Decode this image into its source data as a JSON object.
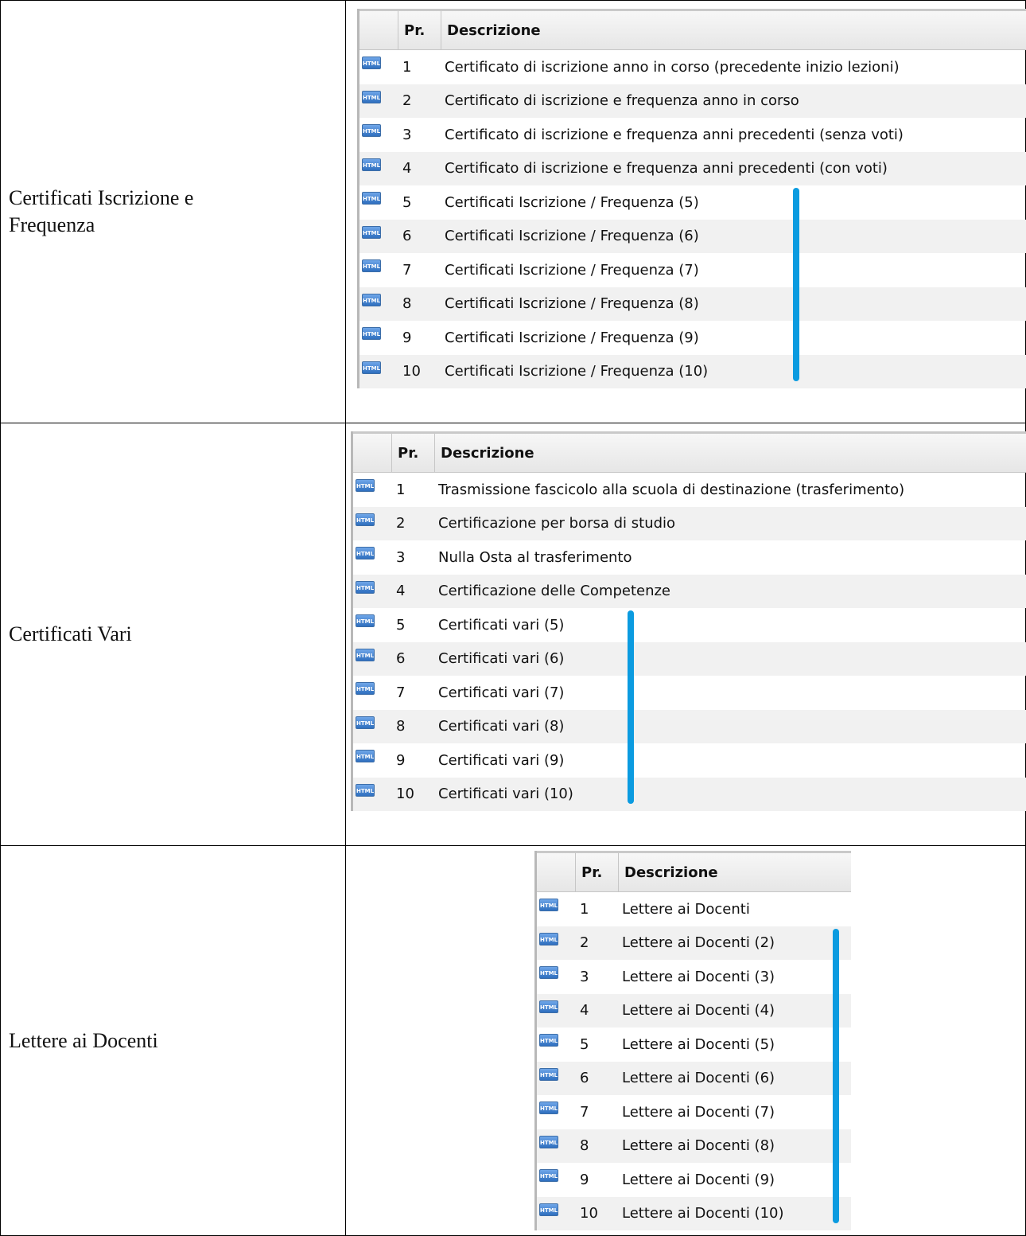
{
  "icon_label": "HTML",
  "sections": [
    {
      "category": "Certificati Iscrizione e Frequenza",
      "header": {
        "pr": "Pr.",
        "desc": "Descrizione"
      },
      "rows": [
        {
          "pr": "1",
          "desc": "Certificato di iscrizione anno in corso (precedente inizio lezioni)"
        },
        {
          "pr": "2",
          "desc": "Certificato di iscrizione e frequenza anno in corso"
        },
        {
          "pr": "3",
          "desc": "Certificato di iscrizione e frequenza anni precedenti (senza voti)"
        },
        {
          "pr": "4",
          "desc": "Certificato di iscrizione e frequenza anni precedenti (con voti)"
        },
        {
          "pr": "5",
          "desc": "Certificati Iscrizione / Frequenza (5)"
        },
        {
          "pr": "6",
          "desc": "Certificati Iscrizione / Frequenza (6)"
        },
        {
          "pr": "7",
          "desc": "Certificati Iscrizione / Frequenza (7)"
        },
        {
          "pr": "8",
          "desc": "Certificati Iscrizione / Frequenza (8)"
        },
        {
          "pr": "9",
          "desc": "Certificati Iscrizione / Frequenza (9)"
        },
        {
          "pr": "10",
          "desc": "Certificati Iscrizione / Frequenza (10)"
        }
      ]
    },
    {
      "category": "Certificati Vari",
      "header": {
        "pr": "Pr.",
        "desc": "Descrizione"
      },
      "rows": [
        {
          "pr": "1",
          "desc": "Trasmissione fascicolo alla scuola di destinazione (trasferimento)"
        },
        {
          "pr": "2",
          "desc": "Certificazione per borsa di studio"
        },
        {
          "pr": "3",
          "desc": "Nulla Osta al trasferimento"
        },
        {
          "pr": "4",
          "desc": "Certificazione delle Competenze"
        },
        {
          "pr": "5",
          "desc": "Certificati vari (5)"
        },
        {
          "pr": "6",
          "desc": "Certificati vari (6)"
        },
        {
          "pr": "7",
          "desc": "Certificati vari (7)"
        },
        {
          "pr": "8",
          "desc": "Certificati vari (8)"
        },
        {
          "pr": "9",
          "desc": "Certificati vari (9)"
        },
        {
          "pr": "10",
          "desc": "Certificati vari (10)"
        }
      ]
    },
    {
      "category": "Lettere ai Docenti",
      "header": {
        "pr": "Pr.",
        "desc": "Descrizione"
      },
      "rows": [
        {
          "pr": "1",
          "desc": "Lettere ai Docenti"
        },
        {
          "pr": "2",
          "desc": "Lettere ai Docenti (2)"
        },
        {
          "pr": "3",
          "desc": "Lettere ai Docenti (3)"
        },
        {
          "pr": "4",
          "desc": "Lettere ai Docenti (4)"
        },
        {
          "pr": "5",
          "desc": "Lettere ai Docenti (5)"
        },
        {
          "pr": "6",
          "desc": "Lettere ai Docenti (6)"
        },
        {
          "pr": "7",
          "desc": "Lettere ai Docenti (7)"
        },
        {
          "pr": "8",
          "desc": "Lettere ai Docenti (8)"
        },
        {
          "pr": "9",
          "desc": "Lettere ai Docenti (9)"
        },
        {
          "pr": "10",
          "desc": "Lettere ai Docenti (10)"
        }
      ]
    }
  ],
  "marker_color": "#0b9be0"
}
